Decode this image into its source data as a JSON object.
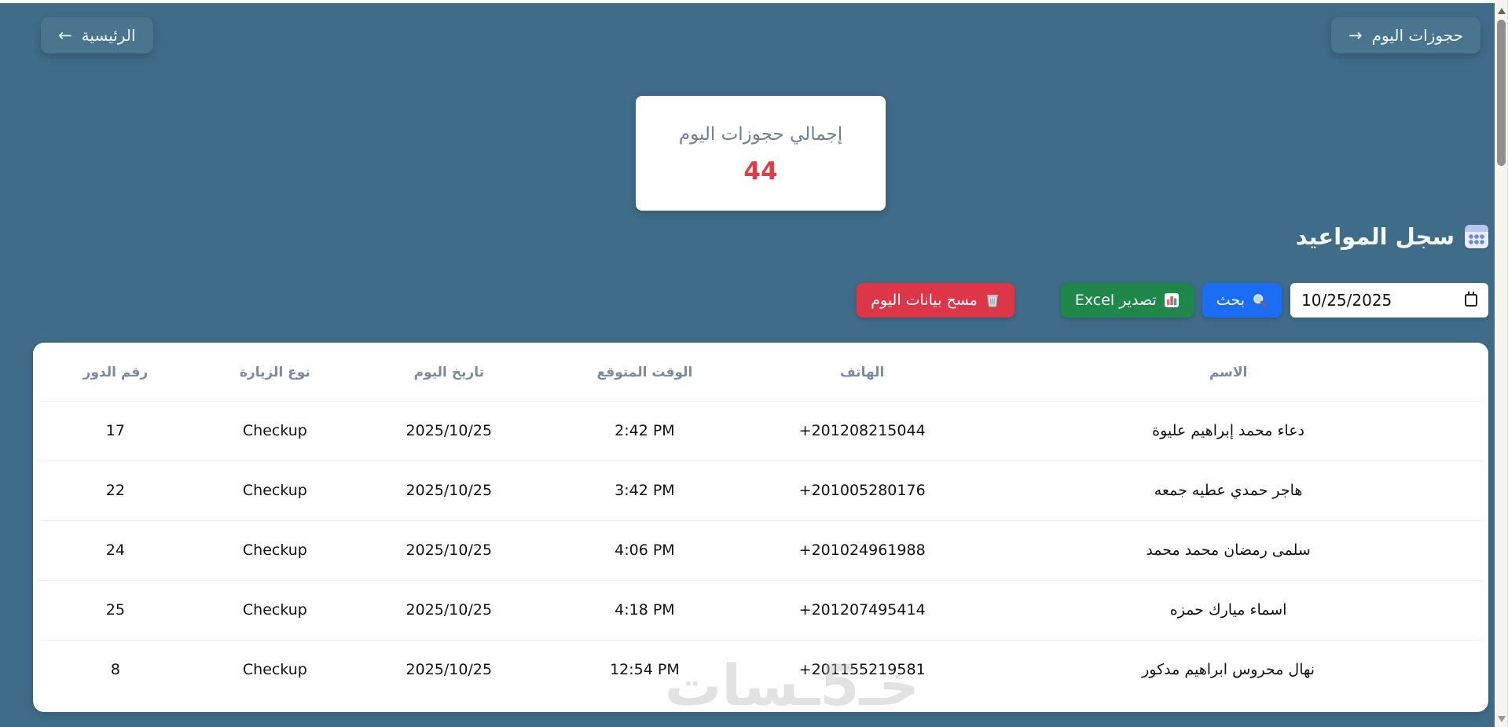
{
  "colors": {
    "page_bg": "#3f6c88",
    "nav_button_bg": "#49758f",
    "summary_value_red": "#e13b47",
    "clear_button_red": "#dc3648",
    "excel_button_green": "#1e8749",
    "search_button_blue": "#1b6ef3",
    "table_header_text": "#7b8b9d"
  },
  "nav": {
    "home": {
      "label": "الرئيسية",
      "arrow": "←"
    },
    "today_bookings": {
      "label": "حجوزات اليوم",
      "arrow": "→"
    }
  },
  "summary": {
    "label": "إجمالي حجوزات اليوم",
    "value": "44"
  },
  "section": {
    "title": "سجل المواعيد",
    "icon": "calendar-icon"
  },
  "controls": {
    "clear": {
      "label": "مسح بيانات اليوم",
      "icon": "trash-icon"
    },
    "excel": {
      "label": "تصدير Excel",
      "icon": "bar-chart-icon"
    },
    "search": {
      "label": "بحث",
      "icon": "magnifier-icon"
    },
    "date": {
      "value": "10/25/2025",
      "icon": "date-picker-icon"
    }
  },
  "table": {
    "headers": {
      "name": "الاسم",
      "phone": "الهاتف",
      "expected_time": "الوقت المتوقع",
      "date": "تاريخ اليوم",
      "visit_type": "نوع الزيارة",
      "queue_number": "رقم الدور"
    },
    "rows": [
      {
        "name": "دعاء محمد إبراهيم عليوة",
        "phone": "+201208215044",
        "expected_time": "2:42 PM",
        "date": "2025/10/25",
        "visit_type": "Checkup",
        "queue_number": "17"
      },
      {
        "name": "هاجر حمدي عطيه جمعه",
        "phone": "+201005280176",
        "expected_time": "3:42 PM",
        "date": "2025/10/25",
        "visit_type": "Checkup",
        "queue_number": "22"
      },
      {
        "name": "سلمى رمضان محمد محمد",
        "phone": "+201024961988",
        "expected_time": "4:06 PM",
        "date": "2025/10/25",
        "visit_type": "Checkup",
        "queue_number": "24"
      },
      {
        "name": "اسماء ميارك حمزه",
        "phone": "+201207495414",
        "expected_time": "4:18 PM",
        "date": "2025/10/25",
        "visit_type": "Checkup",
        "queue_number": "25"
      },
      {
        "name": "نهال محروس ابراهيم مدكور",
        "phone": "+201155219581",
        "expected_time": "12:54 PM",
        "date": "2025/10/25",
        "visit_type": "Checkup",
        "queue_number": "8"
      }
    ]
  },
  "watermark": "خـ5ـسات"
}
